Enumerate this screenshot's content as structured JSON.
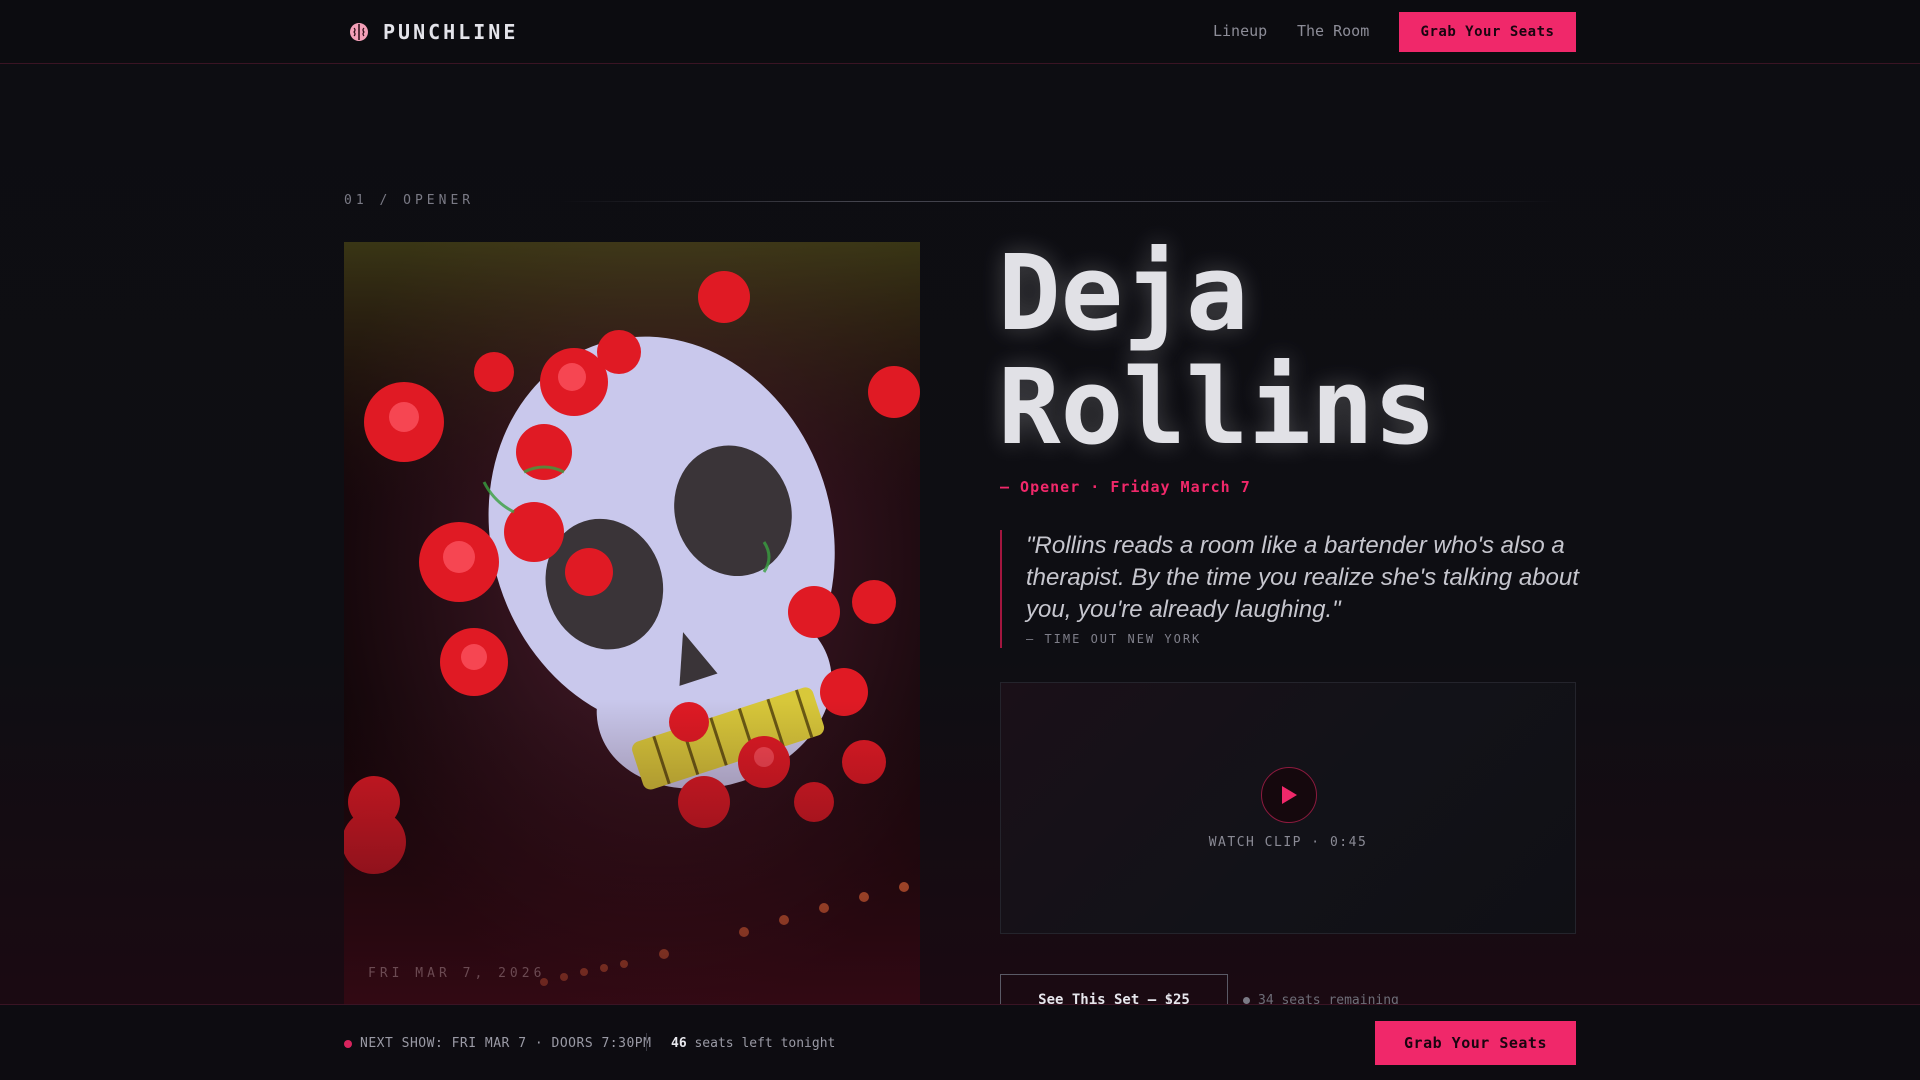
{
  "nav": {
    "brand_icon": "brain-icon",
    "brand_name": "PUNCHLINE",
    "links": [
      "Lineup",
      "The Room"
    ],
    "cta_label": "Grab Your Seats"
  },
  "section": {
    "label": "01 / OPENER"
  },
  "poster": {
    "date": "FRI MAR 7, 2026"
  },
  "performer": {
    "name_line1": "Deja",
    "name_line2": "Rollins",
    "meta": "— Opener · Friday March 7",
    "quote": "\"Rollins reads a room like a bartender who's also a therapist. By the time you realize she's talking about you, you're already laughing.\"",
    "quote_source": "— TIME OUT NEW YORK"
  },
  "video": {
    "play_icon": "play-icon",
    "caption": "WATCH CLIP · 0:45"
  },
  "ticket": {
    "buy_label": "See This Set — $25",
    "seats_remaining": "34 seats remaining"
  },
  "bottom_bar": {
    "next_show": "NEXT SHOW: FRI MAR 7 · DOORS 7:30PM",
    "seats_count": "46",
    "seats_text": "seats left tonight",
    "cta_label": "Grab Your Seats"
  },
  "colors": {
    "accent": "#f0286a",
    "background": "#0d0d12"
  }
}
